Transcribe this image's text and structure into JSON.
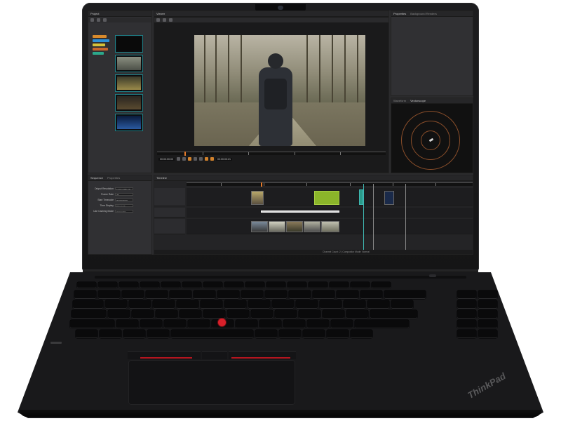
{
  "app": {
    "project_tab": "Project",
    "viewer_tab": "Viewer",
    "properties_tab": "Properties",
    "background_renders_tab": "Background Renders",
    "scope_tab_1": "Waveform",
    "scope_tab_2": "Vectorscope",
    "settings_tab_1": "Sequence",
    "settings_tab_2": "Properties",
    "timeline_tab": "Timeline"
  },
  "viewer": {
    "timecode_in": "00:00:00:00",
    "timecode_out": "00:00:03:21",
    "playhead_fraction": 0.12
  },
  "settings": {
    "rows": [
      {
        "label": "Output Resolution",
        "value": "1920x1080 HD"
      },
      {
        "label": "Frame Rate",
        "value": "25"
      },
      {
        "label": "Start Timecode",
        "value": "00:00:00:00"
      },
      {
        "label": "Time Display",
        "value": "Timecode"
      },
      {
        "label": "Use Caching Mode",
        "value": "Automatic"
      }
    ]
  },
  "timeline": {
    "status": "Channel Count: 2 | Compositor Mode: Normal"
  },
  "brand": {
    "logo": "ThinkPad"
  },
  "colors": {
    "accent_orange": "#e47a2a",
    "accent_teal": "#3fb6b0",
    "trackpoint_red": "#d8202a",
    "clip_green": "#8bb52a"
  },
  "icons": {
    "trackpoint": "red-dot-icon",
    "camera": "camera-icon",
    "power": "power-button-icon"
  }
}
